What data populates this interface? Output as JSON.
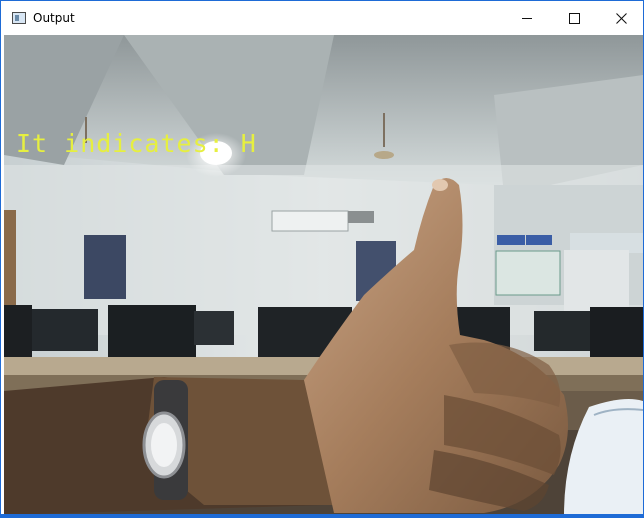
{
  "window": {
    "title": "Output",
    "icon": "window-app-icon",
    "controls": {
      "minimize_icon": "minimize-icon",
      "maximize_icon": "maximize-icon",
      "close_icon": "close-icon"
    },
    "border_color": "#1e6bd6"
  },
  "viewport": {
    "overlay_text": "It indicates: H",
    "overlay_color": "#e6ef40"
  }
}
